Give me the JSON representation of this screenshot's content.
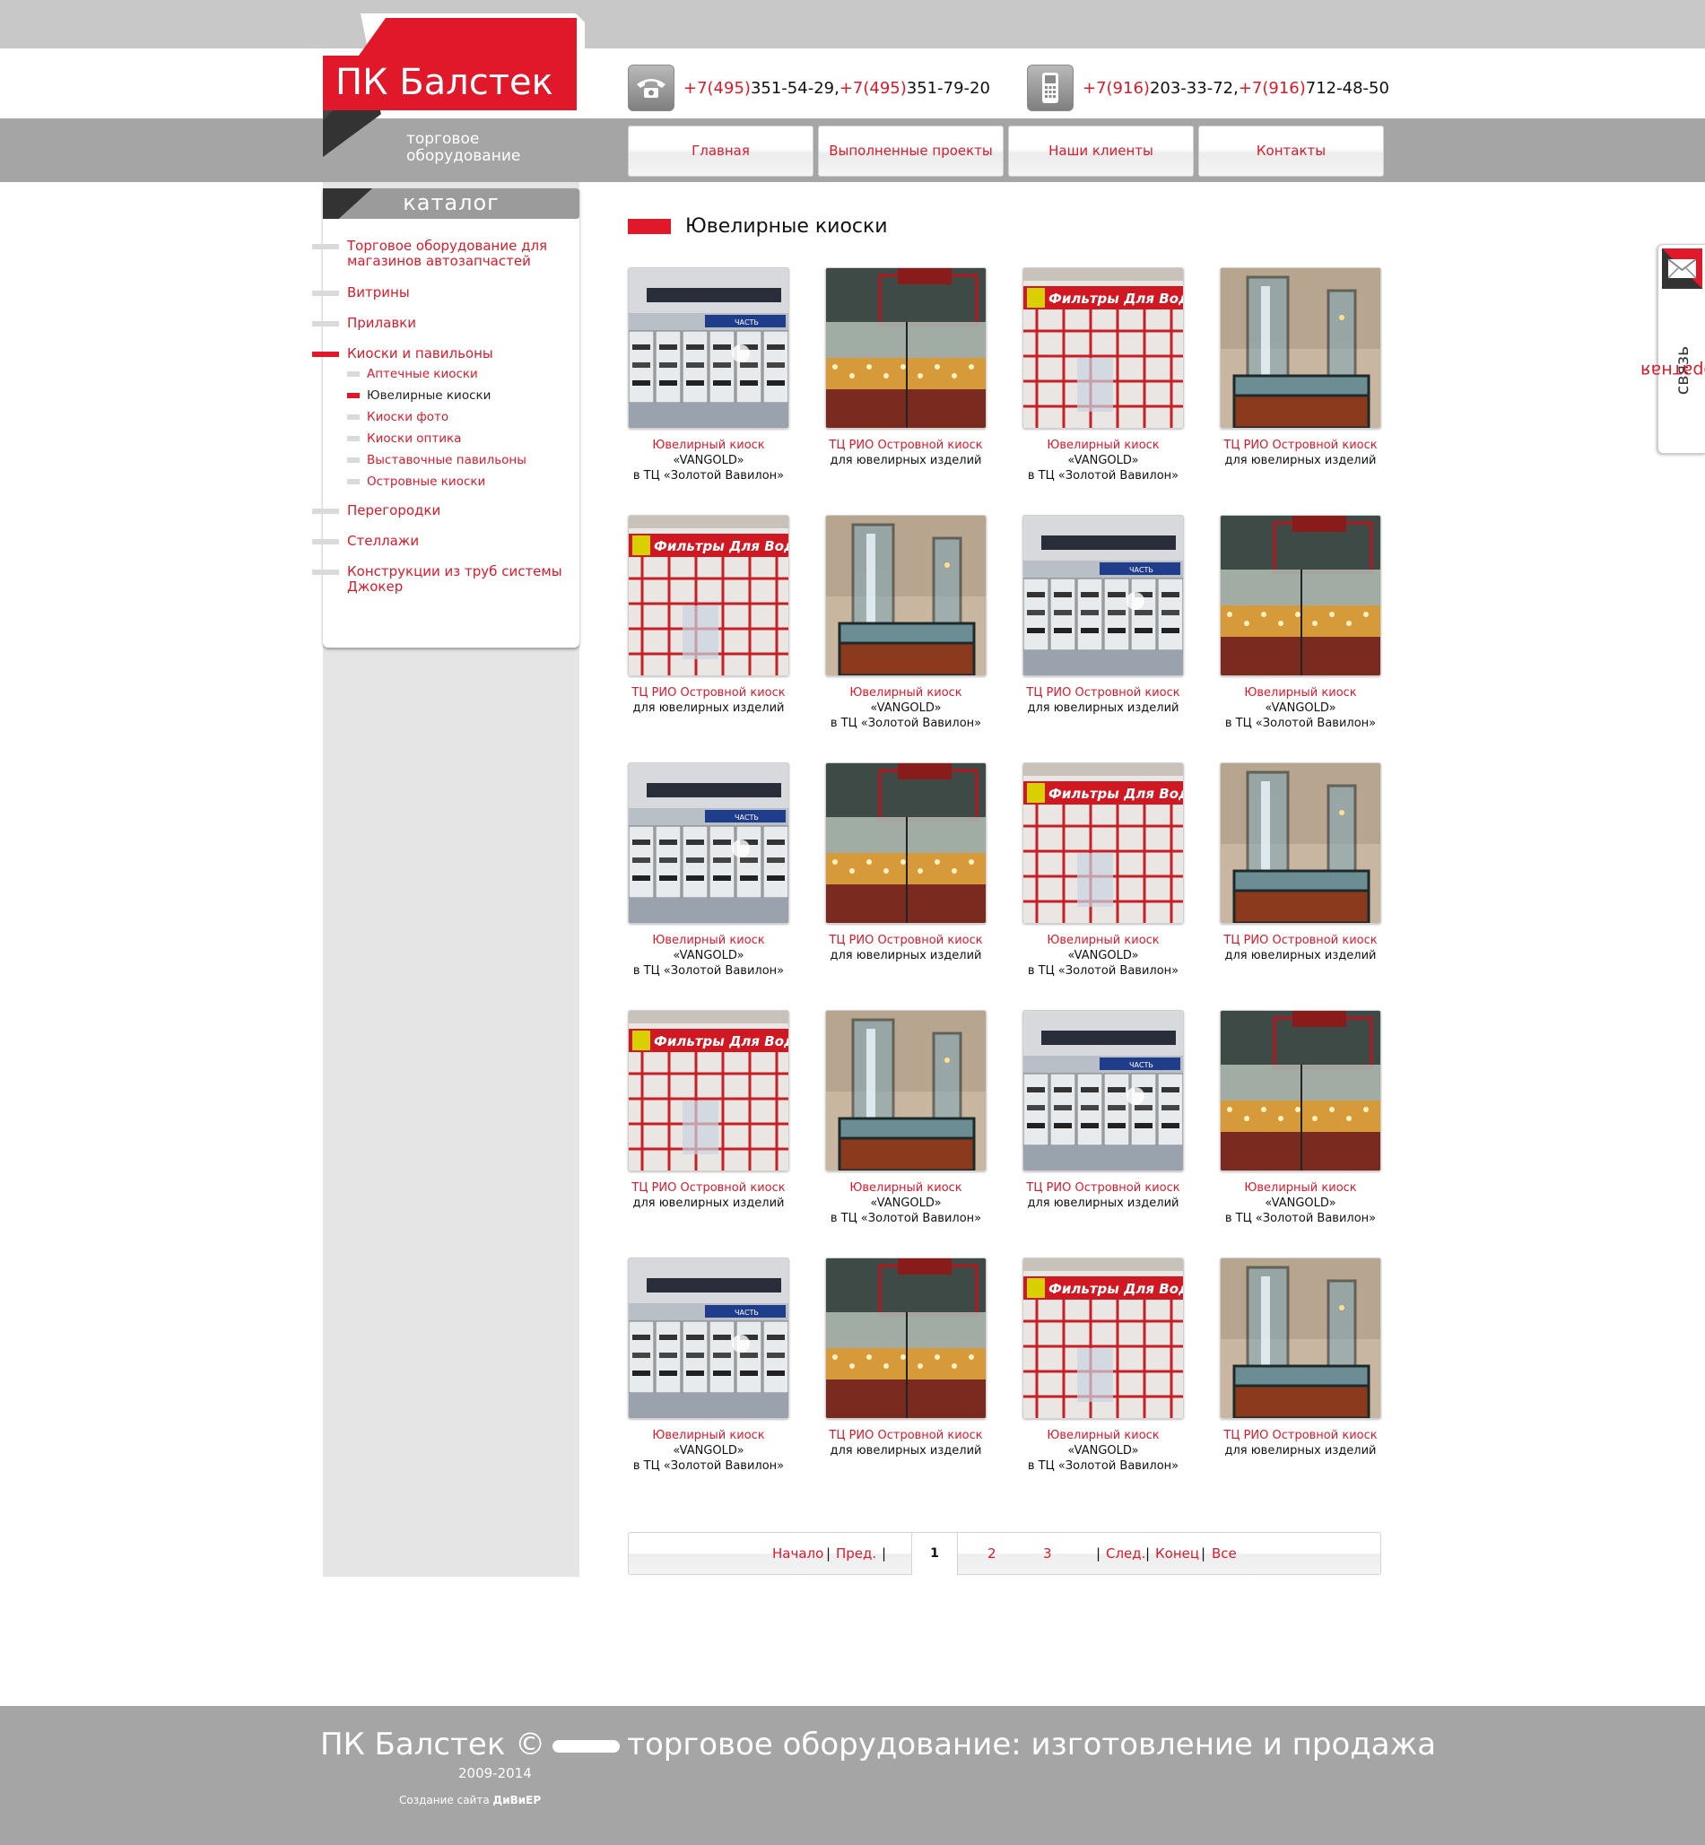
{
  "brand": {
    "name": "ПК Балстек",
    "tagline_line1": "торговое",
    "tagline_line2": "оборудование"
  },
  "contacts": {
    "phone_landline": {
      "code1": "+7(495)",
      "num1": " 351-54-29, ",
      "code2": "+7(495)",
      "num2": " 351-79-20"
    },
    "phone_mobile": {
      "code1": "+7(916)",
      "num1": " 203-33-72, ",
      "code2": "+7(916)",
      "num2": " 712-48-50"
    }
  },
  "nav": [
    "Главная",
    "Выполненные проекты",
    "Наши клиенты",
    "Контакты"
  ],
  "catalog": {
    "title": "каталог",
    "items": [
      {
        "label": "Торговое оборудование для магазинов автозапчастей"
      },
      {
        "label": "Витрины"
      },
      {
        "label": "Прилавки"
      },
      {
        "label": "Киоски и павильоны",
        "active": true
      },
      {
        "label": "Перегородки"
      },
      {
        "label": "Стеллажи"
      },
      {
        "label": "Конструкции из труб системы Джокер"
      }
    ],
    "subitems": [
      {
        "label": "Аптечные киоски"
      },
      {
        "label": "Ювелирные киоски",
        "current": true
      },
      {
        "label": "Киоски фото"
      },
      {
        "label": "Киоски оптика"
      },
      {
        "label": "Выставочные павильоны"
      },
      {
        "label": "Островные киоски"
      }
    ]
  },
  "page_title": "Ювелирные киоски",
  "captions": {
    "a": {
      "title": "Ювелирный киоск",
      "line2": "«VANGOLD»",
      "line3": "в ТЦ «Золотой Вавилон»"
    },
    "b": {
      "title": "ТЦ РИО Островной киоск",
      "line2": "для ювелирных изделий",
      "line3": ""
    }
  },
  "grid_rows": [
    [
      {
        "photo": "store",
        "caption": "a"
      },
      {
        "photo": "counter",
        "caption": "b"
      },
      {
        "photo": "filters",
        "caption": "a"
      },
      {
        "photo": "tower",
        "caption": "b"
      }
    ],
    [
      {
        "photo": "filters",
        "caption": "b"
      },
      {
        "photo": "tower",
        "caption": "a"
      },
      {
        "photo": "store",
        "caption": "b"
      },
      {
        "photo": "counter",
        "caption": "a"
      }
    ],
    [
      {
        "photo": "store",
        "caption": "a"
      },
      {
        "photo": "counter",
        "caption": "b"
      },
      {
        "photo": "filters",
        "caption": "a"
      },
      {
        "photo": "tower",
        "caption": "b"
      }
    ],
    [
      {
        "photo": "filters",
        "caption": "b"
      },
      {
        "photo": "tower",
        "caption": "a"
      },
      {
        "photo": "store",
        "caption": "b"
      },
      {
        "photo": "counter",
        "caption": "a"
      }
    ],
    [
      {
        "photo": "store",
        "caption": "a"
      },
      {
        "photo": "counter",
        "caption": "b"
      },
      {
        "photo": "filters",
        "caption": "a"
      },
      {
        "photo": "tower",
        "caption": "b"
      }
    ]
  ],
  "photo_sign_text": {
    "filters": "Фильтры Для Вод",
    "store_sign": "ЧАСТЬ"
  },
  "pager": {
    "first": "Начало",
    "prev": "Пред.",
    "current": "1",
    "pages": [
      "2",
      "3"
    ],
    "next": "След.",
    "last": "Конец",
    "all": "Все",
    "sep": "|"
  },
  "footer": {
    "line1_left": "ПК Балстек ©",
    "line1_right": "торговое оборудование: изготовление и продажа",
    "years": "2009-2014",
    "credit_prefix": "Создание сайта ",
    "credit_name": "ДиВиЕР"
  },
  "feedback": {
    "word1": "обратная",
    "word2": "связь"
  },
  "colors": {
    "accent": "#e0182a",
    "band": "#a5a5a5",
    "top": "#c8c8c8",
    "sidebar": "#e5e5e5"
  },
  "icons": [
    "phone-icon",
    "mobile-phone-icon",
    "envelope-icon"
  ]
}
